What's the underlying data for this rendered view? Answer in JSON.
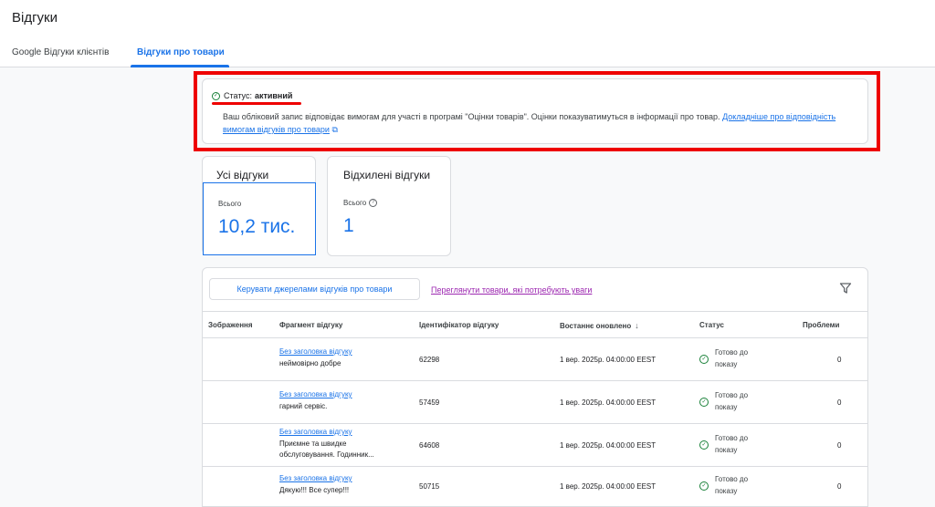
{
  "page": {
    "title": "Відгуки"
  },
  "tabs": [
    {
      "label": "Google Відгуки клієнтів",
      "active": false
    },
    {
      "label": "Відгуки про товари",
      "active": true
    }
  ],
  "status": {
    "prefix": "Статус:",
    "value": "активний",
    "description": "Ваш обліковий запис відповідає вимогам для участі в програмі \"Оцінки товарів\". Оцінки показуватимуться в інформації про товар.",
    "link": "Докладніше про відповідність вимогам відгуків про товари"
  },
  "summary": {
    "all": {
      "title": "Усі відгуки",
      "label": "Всього",
      "value": "10,2 тис."
    },
    "rejected": {
      "title": "Відхилені відгуки",
      "label": "Всього",
      "value": "1"
    }
  },
  "table": {
    "manage_button": "Керувати джерелами відгуків про товари",
    "review_link": "Переглянути товари, які потребують уваги",
    "headers": {
      "image": "Зображення",
      "fragment": "Фрагмент відгуку",
      "id": "Ідентифікатор відгуку",
      "updated": "Востаннє оновлено",
      "status": "Статус",
      "problems": "Проблеми"
    },
    "rows": [
      {
        "title": "Без заголовка відгуку",
        "text": "неймовірно добре",
        "id": "62298",
        "updated": "1 вер. 2025р. 04:00:00 EEST",
        "status": "Готово до показу",
        "problems": "0"
      },
      {
        "title": "Без заголовка відгуку",
        "text": "гарний сервіс.",
        "id": "57459",
        "updated": "1 вер. 2025р. 04:00:00 EEST",
        "status": "Готово до показу",
        "problems": "0"
      },
      {
        "title": "Без заголовка відгуку",
        "text": "Приємне та швидке обслуговування. Годинник...",
        "id": "64608",
        "updated": "1 вер. 2025р. 04:00:00 EEST",
        "status": "Готово до показу",
        "problems": "0"
      },
      {
        "title": "Без заголовка відгуку",
        "text": "Дякую!!! Все супер!!!",
        "id": "50715",
        "updated": "1 вер. 2025р. 04:00:00 EEST",
        "status": "Готово до показу",
        "problems": "0"
      }
    ]
  }
}
